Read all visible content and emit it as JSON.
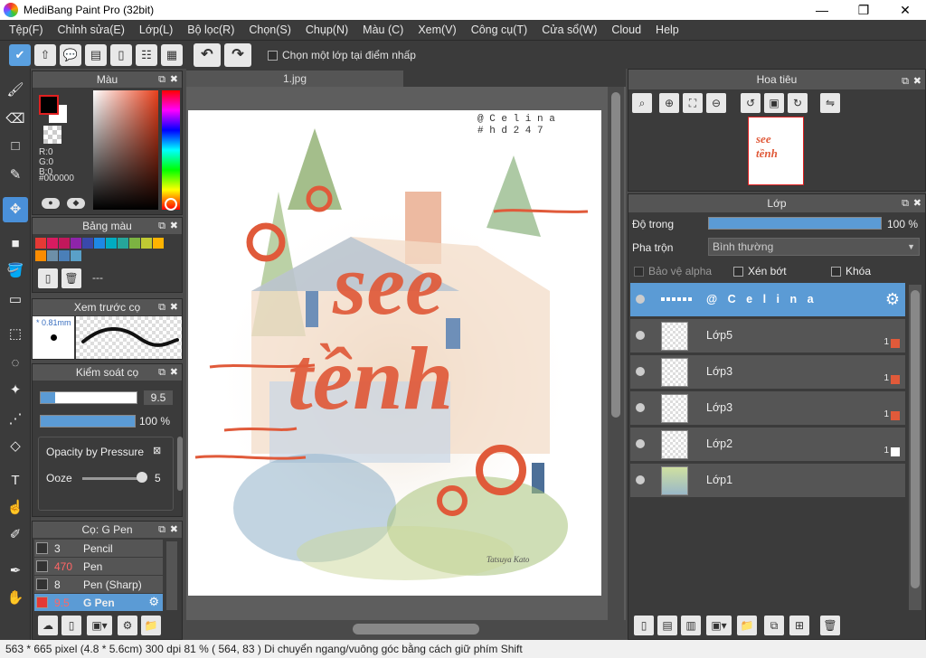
{
  "window": {
    "title": "MediBang Paint Pro (32bit)",
    "minimize": "—",
    "maximize": "❐",
    "close": "✕"
  },
  "menu": [
    "Tệp(F)",
    "Chỉnh sửa(E)",
    "Lớp(L)",
    "Bộ lọc(R)",
    "Chọn(S)",
    "Chụp(N)",
    "Màu (C)",
    "Xem(V)",
    "Công cụ(T)",
    "Cửa sổ(W)",
    "Cloud",
    "Help"
  ],
  "toolbar": {
    "select_one_layer_label": "Chọn một lớp tại điểm nhấp",
    "undo": "↶",
    "redo": "↷"
  },
  "color_panel": {
    "title": "Màu",
    "r": "R:0",
    "g": "G:0",
    "b": "B:0",
    "hex": "#000000",
    "fg": "#000000",
    "bg": "#ffffff"
  },
  "palette_panel": {
    "title": "Bảng màu",
    "dash": "---",
    "colors": [
      "#e53935",
      "#d81b60",
      "#c2185b",
      "#8e24aa",
      "#3949ab",
      "#1e88e5",
      "#00acc1",
      "#26a69a",
      "#7cb342",
      "#c0ca33",
      "#ffb300",
      "#fb8c00",
      "#6d8fa8",
      "#4a7fb8",
      "#5aa0c8"
    ]
  },
  "brush_preview": {
    "title": "Xem trước cọ",
    "size": "* 0.81mm"
  },
  "brush_control": {
    "title": "Kiểm soát cọ",
    "size_value": "9.5",
    "opacity_value": "100 %",
    "size_fill": 0.15,
    "opacity_fill": 1.0,
    "opacity_by_pressure": "Opacity by Pressure",
    "ooze_label": "Ooze",
    "ooze_value": "5"
  },
  "brush_list": {
    "title": "Cọ: G Pen",
    "items": [
      {
        "size": "3",
        "name": "Pencil",
        "color": "#333333",
        "sel": false
      },
      {
        "size": "470",
        "name": "Pen",
        "color": "#333333",
        "sel": false,
        "red": true
      },
      {
        "size": "8",
        "name": "Pen (Sharp)",
        "color": "#333333",
        "sel": false
      },
      {
        "size": "9.5",
        "name": "G Pen",
        "color": "#e53935",
        "sel": true
      }
    ]
  },
  "canvas": {
    "tab": "1.jpg",
    "watermark_line1": "@ C e l i n a",
    "watermark_line2": "# h d 2 4 7",
    "art_line1": "see",
    "art_line2": "tềnh",
    "signature": "Tatsuya Kato"
  },
  "navigator": {
    "title": "Hoa tiêu"
  },
  "layer_panel": {
    "title": "Lớp",
    "opacity_label": "Độ trong",
    "opacity_value": "100 %",
    "opacity_fill": 1.0,
    "blend_label": "Pha trộn",
    "blend_value": "Bình thường",
    "protect_alpha": "Bảo vệ alpha",
    "clipping": "Xén bớt",
    "lock": "Khóa",
    "layers": [
      {
        "name": "@ C e l i n a",
        "sel": true,
        "num": "",
        "sw": ""
      },
      {
        "name": "Lớp5",
        "sel": false,
        "num": "1",
        "sw": "#e05a3a"
      },
      {
        "name": "Lớp3",
        "sel": false,
        "num": "1",
        "sw": "#e05a3a"
      },
      {
        "name": "Lớp3",
        "sel": false,
        "num": "1",
        "sw": "#e05a3a"
      },
      {
        "name": "Lớp2",
        "sel": false,
        "num": "1",
        "sw": "#ffffff"
      },
      {
        "name": "Lớp1",
        "sel": false,
        "num": "",
        "sw": ""
      }
    ]
  },
  "status": "563 * 665 pixel   (4.8 * 5.6cm)   300 dpi   81 %   ( 564, 83 )   Di chuyển ngang/vuông góc bằng cách giữ phím Shift"
}
